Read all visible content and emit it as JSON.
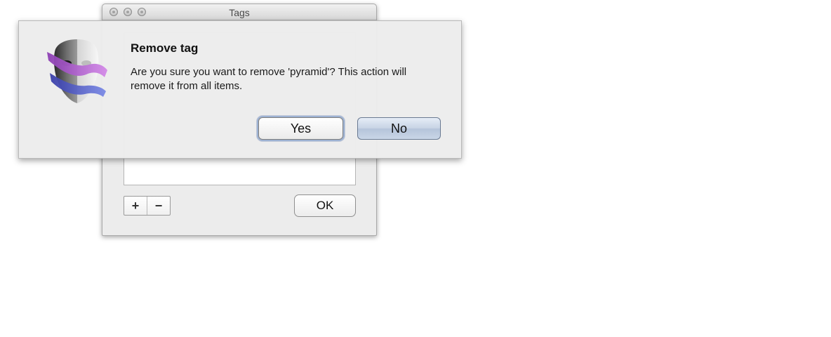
{
  "tags_window": {
    "title": "Tags",
    "add_label": "+",
    "remove_label": "−",
    "ok_label": "OK"
  },
  "alert": {
    "title": "Remove tag",
    "message": "Are you sure you want to remove 'pyramid'? This action will remove it from all items.",
    "yes_label": "Yes",
    "no_label": "No",
    "icon": "mask-icon"
  },
  "colors": {
    "ribbon_purple": "#b36bd1",
    "ribbon_blue": "#5a6bd0",
    "default_button": "#c8d4e5"
  }
}
